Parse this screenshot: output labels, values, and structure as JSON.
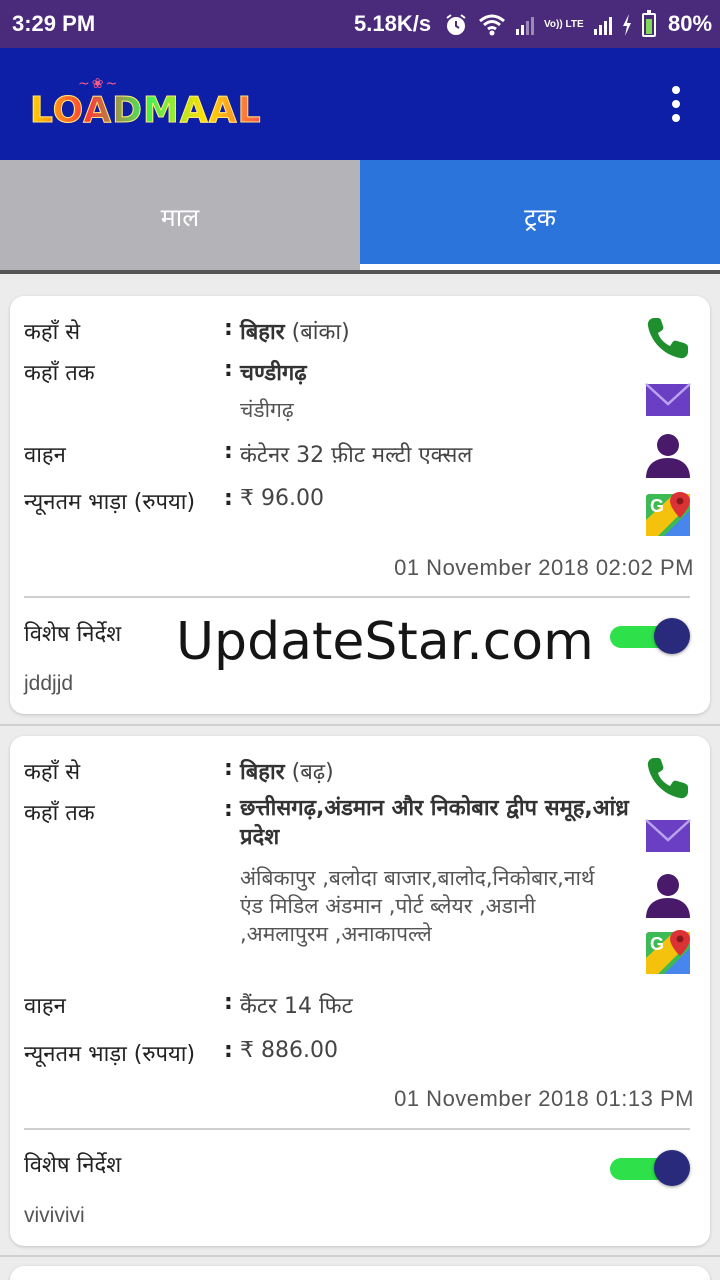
{
  "status_bar": {
    "time": "3:29 PM",
    "speed": "5.18K/s",
    "volte": "Vo)) LTE",
    "battery": "80%",
    "icons": [
      "alarm-icon",
      "wifi-icon",
      "signal-icon",
      "charging-icon",
      "battery-icon"
    ]
  },
  "app_bar": {
    "logo_text": "LOADMAAL"
  },
  "tabs": [
    {
      "label": "माल",
      "active": false
    },
    {
      "label": "ट्रक",
      "active": true
    }
  ],
  "colors": {
    "status_bar": "#4a2a7a",
    "app_bar": "#0d1fa6",
    "active_tab": "#2a74dc",
    "inactive_tab": "#b4b4b8",
    "toggle_track": "#2ee04a",
    "toggle_thumb": "#2a2a7c",
    "phone_icon": "#1f8f2e",
    "mail_icon": "#6a3fc4",
    "user_icon": "#4a1a6a"
  },
  "labels": {
    "from": "कहाँ से",
    "to": "कहाँ तक",
    "vehicle": "वाहन",
    "min_fare": "न्यूनतम भाड़ा (रुपया)",
    "special_instructions": "विशेष निर्देश",
    "colon": ":"
  },
  "watermark": "UpdateStar.com",
  "listings": [
    {
      "from_state": "बिहार",
      "from_district": "(बांका)",
      "to_state": "चण्डीगढ़",
      "to_cities": "चंडीगढ़",
      "vehicle": "कंटेनर 32 फ़ीट  मल्टी एक्सल",
      "fare": "₹ 96.00",
      "datetime": "01 November 2018  02:02 PM",
      "note": "jddjjd",
      "toggle_on": true
    },
    {
      "from_state": "बिहार",
      "from_district": "(बढ़)",
      "to_state": "छत्तीसगढ़,अंडमान और निकोबार द्वीप समूह,आंध्र प्रदेश",
      "to_cities": "अंबिकापुर ,बलोदा बाजार,बालोद,निकोबार,नार्थ एंड मिडिल अंडमान ,पोर्ट ब्लेयर ,अडानी ,अमलापुरम ,अनाकापल्ले",
      "vehicle": "कैंटर 14 फिट",
      "fare": "₹ 886.00",
      "datetime": "01 November 2018  01:13 PM",
      "note": "vivivivi",
      "toggle_on": true
    }
  ]
}
